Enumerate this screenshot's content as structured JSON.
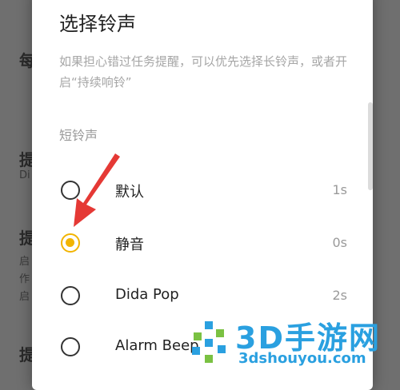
{
  "background": {
    "items": [
      "每",
      "提",
      "Di",
      "提",
      "启",
      "作",
      "启",
      "提"
    ]
  },
  "dialog": {
    "title": "选择铃声",
    "description": "如果担心错过任务提醒，可以优先选择长铃声，或者开启“持续响铃”",
    "section_label": "短铃声",
    "options": [
      {
        "label": "默认",
        "duration": "1s",
        "selected": false
      },
      {
        "label": "静音",
        "duration": "0s",
        "selected": true
      },
      {
        "label": "Dida Pop",
        "duration": "2s",
        "selected": false
      },
      {
        "label": "Alarm Beep",
        "duration": "",
        "selected": false
      }
    ]
  },
  "watermark": {
    "main": "3D手游网",
    "sub": "3dshouyou.com"
  },
  "colors": {
    "accent": "#f2b400",
    "arrow": "#e53935",
    "watermark": "#2aa0e0"
  }
}
